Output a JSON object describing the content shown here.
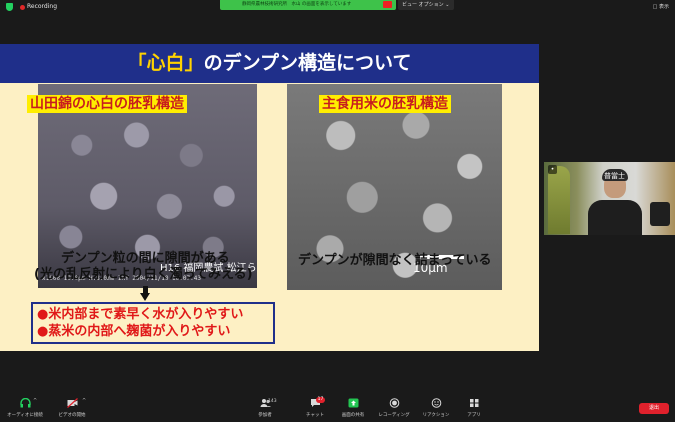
{
  "topbar": {
    "recording_label": "Recording",
    "share_text": "静岡県農林技術研究所　水山 の画面を表示しています",
    "view_options": "ビュー オプション",
    "display_label": "表示"
  },
  "slide": {
    "title_open_bracket": "「",
    "title_accent": "心白",
    "title_close_bracket": "」",
    "title_rest": "のデンプン構造について",
    "left_label": "山田錦の心白の胚乳構造",
    "left_credit": "H16 福岡農試 松江ら",
    "left_meta": "x1000  10.0μm  H.8.0mm  IKY 2004/11/10 10:07:43",
    "right_label": "主食用米の胚乳構造",
    "right_scale": "10μm",
    "caption_left_1": "デンプン粒の間に隙間がある",
    "caption_left_2": "(光の乱反射により白く濁ってみえる)",
    "caption_right": "デンプンが隙間なく詰まっている",
    "bullet_1": "●米内部まで素早く水が入りやすい",
    "bullet_2": "●蒸米の内部へ麹菌が入りやすい"
  },
  "camera": {
    "name": "普當士",
    "mic_icon": "mic-icon"
  },
  "toolbar": {
    "audio_label": "オーディオに接続",
    "video_label": "ビデオの開始",
    "participants_label": "参加者",
    "participants_count": "143",
    "chat_label": "チャット",
    "chat_badge": "17",
    "share_label": "画面の共有",
    "record_label": "レコーディング",
    "react_label": "リアクション",
    "apps_label": "アプリ",
    "leave_label": "退出"
  },
  "colors": {
    "slide_bg": "#fdf0c4",
    "header_blue": "#1f2f8a",
    "title_accent": "#ffd200",
    "label_yellow": "#ffee00",
    "label_red": "#c81e1e",
    "bullet_red": "#e01818",
    "share_green": "#3ec24a",
    "leave_red": "#e0212c"
  }
}
